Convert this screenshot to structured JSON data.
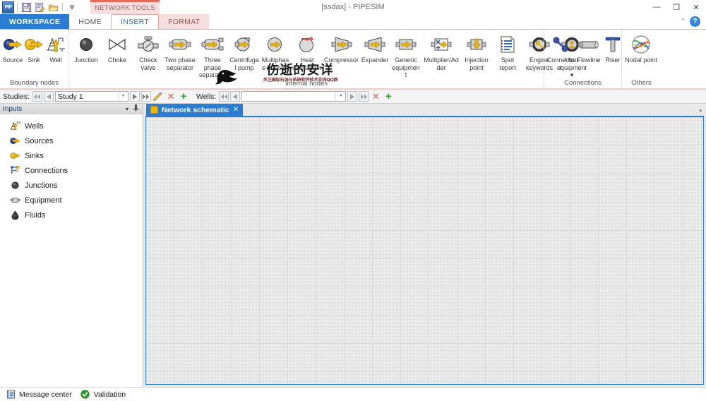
{
  "window": {
    "title": "[ssdax] - PIPESIM",
    "quick_access": [
      {
        "name": "app-logo-icon",
        "label": "PIP"
      },
      {
        "name": "save-icon",
        "label": "Save"
      },
      {
        "name": "new-study-icon",
        "label": "New"
      },
      {
        "name": "open-folder-icon",
        "label": "Open"
      },
      {
        "name": "qat-more-icon",
        "label": "More"
      }
    ],
    "controls": {
      "minimize": "—",
      "maximize": "❐",
      "close": "✕"
    }
  },
  "ribbon": {
    "contextual_group": "NETWORK TOOLS",
    "tabs": [
      {
        "label": "WORKSPACE",
        "kind": "workspace"
      },
      {
        "label": "HOME",
        "kind": "normal"
      },
      {
        "label": "INSERT",
        "kind": "active"
      },
      {
        "label": "FORMAT",
        "kind": "ctx"
      }
    ],
    "collapse_label": "⌃",
    "help_label": "?",
    "groups": [
      {
        "title": "Boundary nodes",
        "items": [
          {
            "label": "Source",
            "icon": "source-icon"
          },
          {
            "label": "Sink",
            "icon": "sink-icon"
          },
          {
            "label": "Well",
            "icon": "well-icon"
          }
        ]
      },
      {
        "title": "Internal nodes",
        "items": [
          {
            "label": "Junction",
            "icon": "junction-icon"
          },
          {
            "label": "Choke",
            "icon": "choke-icon"
          },
          {
            "label": "Check valve",
            "icon": "check-valve-icon"
          },
          {
            "label": "Two phase separator",
            "icon": "two-phase-separator-icon"
          },
          {
            "label": "Three phase separator",
            "icon": "three-phase-separator-icon"
          },
          {
            "label": "Centrifugal pump",
            "icon": "centrifugal-pump-icon"
          },
          {
            "label": "Multiphase booster",
            "icon": "multiphase-booster-icon"
          },
          {
            "label": "Heat exchanger",
            "icon": "heat-exchanger-icon"
          },
          {
            "label": "Compressor",
            "icon": "compressor-icon"
          },
          {
            "label": "Expander",
            "icon": "expander-icon"
          },
          {
            "label": "Generic equipment",
            "icon": "generic-equipment-icon"
          },
          {
            "label": "Multiplier/Adder",
            "icon": "multiplier-adder-icon"
          },
          {
            "label": "Injection point",
            "icon": "injection-point-icon"
          },
          {
            "label": "Spot report",
            "icon": "spot-report-icon"
          },
          {
            "label": "Engine keywords",
            "icon": "engine-keywords-icon"
          },
          {
            "label": "User equipment ▾",
            "icon": "user-equipment-icon"
          }
        ]
      },
      {
        "title": "Connections",
        "items": [
          {
            "label": "Connector",
            "icon": "connector-icon"
          },
          {
            "label": "Flowline",
            "icon": "flowline-icon"
          },
          {
            "label": "Riser",
            "icon": "riser-icon"
          }
        ]
      },
      {
        "title": "Others",
        "items": [
          {
            "label": "Nodal point",
            "icon": "nodal-point-icon"
          }
        ]
      }
    ]
  },
  "studies_bar": {
    "studies_label": "Studies:",
    "studies_value": "Study 1",
    "wells_label": "Wells:",
    "wells_value": "",
    "nav": {
      "first": "◀◀",
      "prev": "◀",
      "next": "▶",
      "last": "▶▶"
    },
    "edit_label": "✎",
    "delete_label": "✕",
    "add_label": "+"
  },
  "sidebar": {
    "header": "Inputs",
    "header_icons": [
      {
        "name": "panel-dropdown-icon",
        "glyph": "▾"
      },
      {
        "name": "panel-pin-icon",
        "glyph": "⚲"
      }
    ],
    "items": [
      {
        "label": "Wells",
        "icon": "wells-icon"
      },
      {
        "label": "Sources",
        "icon": "sources-icon"
      },
      {
        "label": "Sinks",
        "icon": "sinks-icon"
      },
      {
        "label": "Connections",
        "icon": "connections-icon"
      },
      {
        "label": "Junctions",
        "icon": "junctions-icon"
      },
      {
        "label": "Equipment",
        "icon": "equipment-icon"
      },
      {
        "label": "Fluids",
        "icon": "fluids-icon"
      }
    ]
  },
  "document": {
    "tab_label": "Network schematic",
    "tab_close": "✕",
    "tabs_overflow": "▾"
  },
  "statusbar": {
    "items": [
      {
        "label": "Message center",
        "icon": "message-center-icon"
      },
      {
        "label": "Validation",
        "icon": "validation-ok-icon"
      }
    ]
  },
  "watermark": {
    "main": "伤逝的安详",
    "sub": "关注国际石油与系统软件技术交流QQ群"
  },
  "colors": {
    "accent": "#2b7cd3",
    "contextual": "#e8665b",
    "contextual_bg": "#f6dede",
    "ok_green": "#2aa02a",
    "delete_red": "#e05c4f"
  }
}
